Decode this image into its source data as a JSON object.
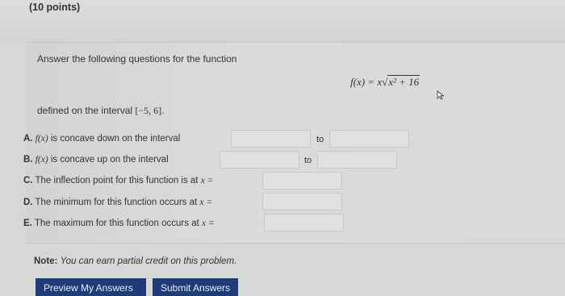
{
  "header": {
    "points_label": "(10 points)"
  },
  "problem": {
    "intro": "Answer the following questions for the function",
    "function_lhs": "f(x) = x",
    "function_radicand": "x² + 16",
    "domain_prefix": "defined on the interval ",
    "domain_interval": "[−5, 6]",
    "domain_suffix": "."
  },
  "questions": [
    {
      "letter": "A.",
      "fx": "f(x)",
      "text": " is concave down on the interval",
      "has_to": true,
      "to_label": "to",
      "value_from": "",
      "value_to": ""
    },
    {
      "letter": "B.",
      "fx": "f(x)",
      "text": " is concave up on the interval",
      "has_to": true,
      "to_label": "to",
      "value_from": "",
      "value_to": ""
    },
    {
      "letter": "C.",
      "fx": "",
      "text": "The inflection point for this function is at ",
      "var": "x =",
      "has_to": false,
      "value": ""
    },
    {
      "letter": "D.",
      "fx": "",
      "text": "The minimum for this function occurs at ",
      "var": "x =",
      "has_to": false,
      "value": ""
    },
    {
      "letter": "E.",
      "fx": "",
      "text": "The maximum for this function occurs at ",
      "var": "x =",
      "has_to": false,
      "value": ""
    }
  ],
  "note": {
    "label": "Note:",
    "text": "You can earn partial credit on this problem."
  },
  "buttons": {
    "preview": "Preview My Answers",
    "submit": "Submit Answers"
  },
  "colors": {
    "button_bg": "#1f3b78",
    "input_bg": "#dfe1df"
  }
}
